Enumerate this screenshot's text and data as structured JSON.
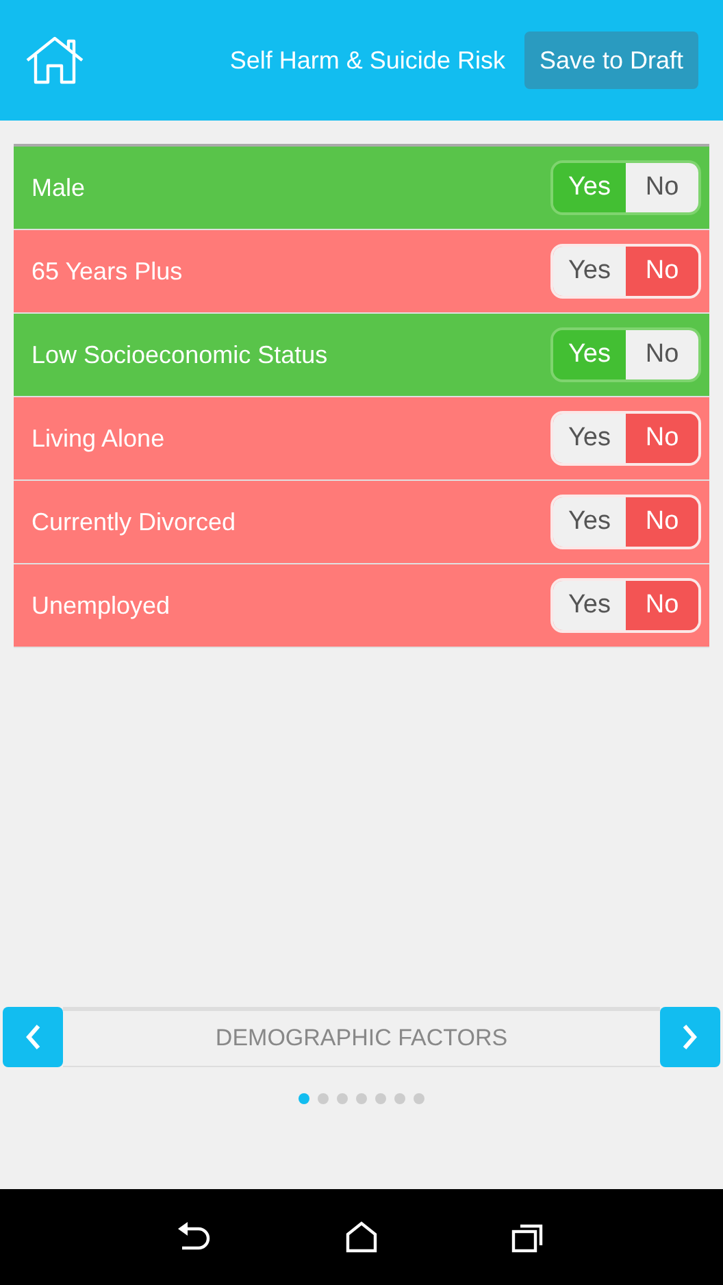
{
  "header": {
    "title": "Self Harm & Suicide Risk",
    "save_button": "Save to Draft"
  },
  "factors": [
    {
      "label": "Male",
      "options": [
        {
          "label": "Yes",
          "selected": true
        },
        {
          "label": "No",
          "selected": false
        }
      ]
    },
    {
      "label": "65 Years Plus",
      "options": [
        {
          "label": "Yes",
          "selected": false
        },
        {
          "label": "No",
          "selected": true
        }
      ]
    },
    {
      "label": "Low Socioeconomic Status",
      "options": [
        {
          "label": "Yes",
          "selected": true
        },
        {
          "label": "No",
          "selected": false
        }
      ]
    },
    {
      "label": "Living Alone",
      "options": [
        {
          "label": "Yes",
          "selected": false
        },
        {
          "label": "No",
          "selected": true
        }
      ]
    },
    {
      "label": "Currently Divorced",
      "options": [
        {
          "label": "Yes",
          "selected": false
        },
        {
          "label": "No",
          "selected": true
        }
      ]
    },
    {
      "label": "Unemployed",
      "options": [
        {
          "label": "Yes",
          "selected": false
        },
        {
          "label": "No",
          "selected": true
        }
      ]
    }
  ],
  "section": {
    "title": "DEMOGRAPHIC FACTORS"
  },
  "pages": [
    {
      "selected": true
    },
    {
      "selected": false
    },
    {
      "selected": false
    },
    {
      "selected": false
    },
    {
      "selected": false
    },
    {
      "selected": false
    },
    {
      "selected": false
    }
  ]
}
